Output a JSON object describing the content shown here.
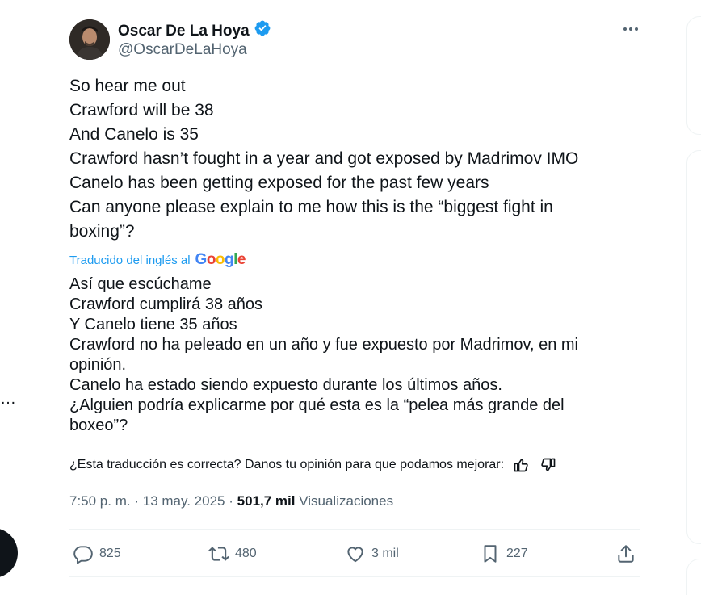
{
  "left_nav": {
    "more_glyph": "…"
  },
  "tweet": {
    "author": {
      "display_name": "Oscar De La Hoya",
      "handle": "@OscarDeLaHoya",
      "verified_icon": "verified-badge-icon",
      "verified_color": "#1d9bf0"
    },
    "more_icon": "more-horizontal-icon",
    "original_lines": [
      "So hear me out",
      "Crawford will be 38",
      "And Canelo is 35",
      "Crawford hasn’t fought in a year and got exposed by Madrimov IMO",
      "Canelo has been getting exposed for the past few years",
      "Can anyone please explain to me how this is the “biggest fight in",
      "boxing”?"
    ],
    "translation_credit": {
      "label": "Traducido del inglés al",
      "provider": "Google"
    },
    "translated_lines": [
      "Así que escúchame",
      "Crawford cumplirá 38 años",
      "Y Canelo tiene 35 años",
      "Crawford no ha peleado en un año y fue expuesto por Madrimov, en mi",
      "opinión.",
      "Canelo ha estado siendo expuesto durante los últimos años.",
      "¿Alguien podría explicarme por qué esta es la “pelea más grande del",
      "boxeo”?"
    ],
    "feedback": {
      "question": "¿Esta traducción es correcta? Danos tu opinión para que podamos mejorar:",
      "thumbs_up_icon": "thumbs-up-icon",
      "thumbs_down_icon": "thumbs-down-icon"
    },
    "meta": {
      "time": "7:50 p. m.",
      "separator": "·",
      "date": "13 may. 2025",
      "views_count": "501,7 mil",
      "views_label": "Visualizaciones"
    },
    "actions": {
      "reply": {
        "icon": "reply-icon",
        "count": "825"
      },
      "repost": {
        "icon": "repost-icon",
        "count": "480"
      },
      "like": {
        "icon": "heart-icon",
        "count": "3 mil"
      },
      "bookmark": {
        "icon": "bookmark-icon",
        "count": "227"
      },
      "share": {
        "icon": "share-icon"
      }
    }
  },
  "colors": {
    "text_primary": "#0f1419",
    "text_secondary": "#536471",
    "accent": "#1d9bf0",
    "border": "#eff3f4"
  }
}
